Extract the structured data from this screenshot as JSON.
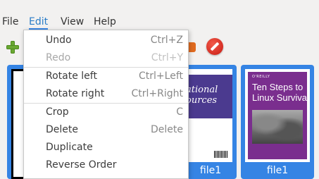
{
  "menubar": {
    "items": [
      {
        "label": "File"
      },
      {
        "label": "Edit"
      },
      {
        "label": "View"
      },
      {
        "label": "Help"
      }
    ]
  },
  "edit_menu": {
    "items": [
      {
        "label": "Undo",
        "accel": "Ctrl+Z",
        "enabled": true
      },
      {
        "label": "Redo",
        "accel": "Ctrl+Y",
        "enabled": false
      },
      {
        "label": "Rotate left",
        "accel": "Ctrl+Left",
        "enabled": true
      },
      {
        "label": "Rotate right",
        "accel": "Ctrl+Right",
        "enabled": true
      },
      {
        "label": "Crop",
        "accel": "C",
        "enabled": true
      },
      {
        "label": "Delete",
        "accel": "Delete",
        "enabled": true
      },
      {
        "label": "Duplicate",
        "accel": "",
        "enabled": true
      },
      {
        "label": "Reverse Order",
        "accel": "",
        "enabled": true
      }
    ]
  },
  "toolbar": {
    "icons": [
      "add-icon",
      "export-icon",
      "stop-icon"
    ]
  },
  "thumbnails": [
    {
      "caption": ""
    },
    {
      "caption": "file1",
      "cover_title": "ational\nources"
    },
    {
      "caption": "file1",
      "cover_logo": "O'REILLY",
      "cover_title": "Ten Steps to\nLinux Survival"
    }
  ],
  "colors": {
    "selection_blue": "#3584e4",
    "menu_accent": "#2a7cc7",
    "add_green": "#6aa832",
    "stop_red": "#c81a12",
    "book_purple": "#7a2e8e",
    "book_indigo": "#4b3a8f"
  }
}
